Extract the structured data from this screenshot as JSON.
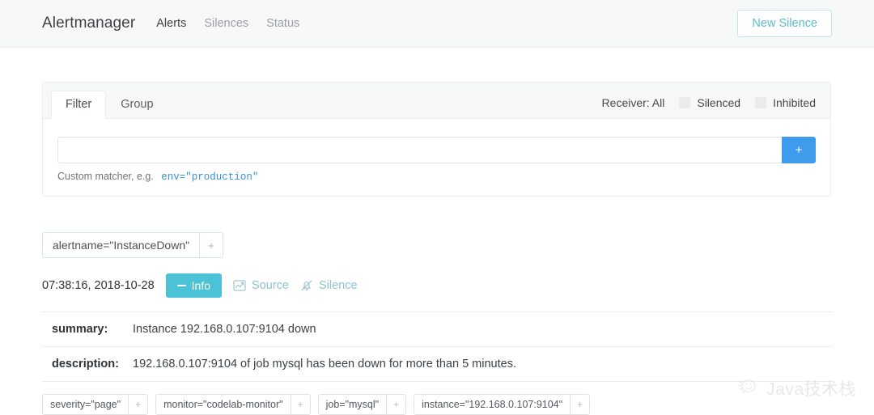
{
  "navbar": {
    "brand": "Alertmanager",
    "links": [
      {
        "label": "Alerts",
        "active": true
      },
      {
        "label": "Silences",
        "active": false
      },
      {
        "label": "Status",
        "active": false
      }
    ],
    "new_silence_label": "New Silence",
    "accent_color": "#5bbccb"
  },
  "filter_card": {
    "tabs": [
      {
        "label": "Filter",
        "active": true
      },
      {
        "label": "Group",
        "active": false
      }
    ],
    "receiver_label": "Receiver: All",
    "checkboxes": [
      {
        "label": "Silenced",
        "checked": false
      },
      {
        "label": "Inhibited",
        "checked": false
      }
    ],
    "matcher_input": {
      "value": "",
      "placeholder": ""
    },
    "add_button_label": "+",
    "add_button_color": "#3f9bec",
    "help_prefix": "Custom matcher, e.g.",
    "help_example": "env=\"production\"",
    "help_example_color": "#3c92d6"
  },
  "alert": {
    "filter_chips": [
      {
        "text": "alertname=\"InstanceDown\"",
        "plus": "+"
      }
    ],
    "timestamp": "07:38:16, 2018-10-28",
    "info_button": {
      "label": "Info",
      "icon": "minus-icon",
      "color": "#4cc2d6"
    },
    "actions": [
      {
        "label": "Source",
        "icon": "chart-line-icon"
      },
      {
        "label": "Silence",
        "icon": "bell-slash-icon"
      }
    ],
    "details": [
      {
        "key": "summary:",
        "value": "Instance 192.168.0.107:9104 down"
      },
      {
        "key": "description:",
        "value": "192.168.0.107:9104 of job mysql has been down for more than 5 minutes."
      }
    ],
    "labels": [
      {
        "text": "severity=\"page\"",
        "plus": "+"
      },
      {
        "text": "monitor=\"codelab-monitor\"",
        "plus": "+"
      },
      {
        "text": "job=\"mysql\"",
        "plus": "+"
      },
      {
        "text": "instance=\"192.168.0.107:9104\"",
        "plus": "+"
      }
    ]
  },
  "watermark": {
    "text": "Java技术栈",
    "icon": "wechat-face-icon"
  }
}
